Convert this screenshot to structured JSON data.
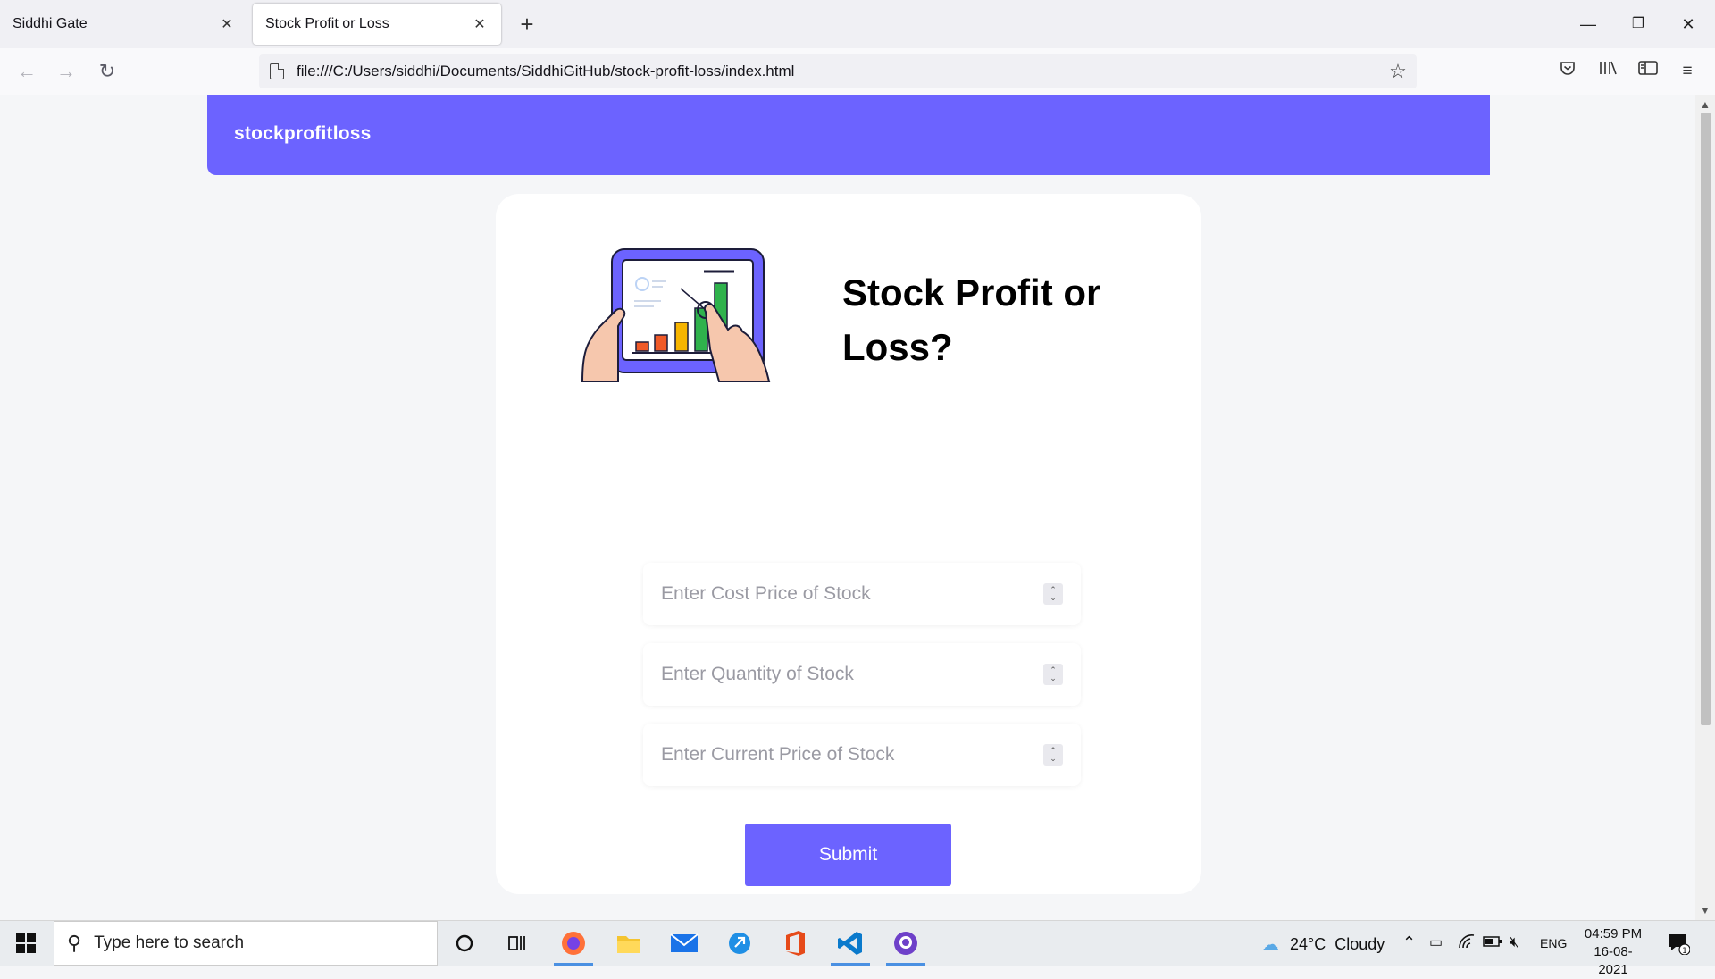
{
  "browser": {
    "tabs": [
      {
        "title": "Siddhi Gate",
        "active": false
      },
      {
        "title": "Stock Profit or Loss",
        "active": true
      }
    ],
    "url": "file:///C:/Users/siddhi/Documents/SiddhiGitHub/stock-profit-loss/index.html",
    "window_controls": {
      "minimize": "—",
      "restore": "❐",
      "close": "✕"
    }
  },
  "page": {
    "brand": "stockprofitloss",
    "title": "Stock Profit or Loss?",
    "title_line1": "Stock Profit or",
    "title_line2": "Loss?",
    "inputs": [
      {
        "placeholder": "Enter Cost Price of Stock",
        "value": ""
      },
      {
        "placeholder": "Enter Quantity of Stock",
        "value": ""
      },
      {
        "placeholder": "Enter Current Price of Stock",
        "value": ""
      }
    ],
    "submit_label": "Submit",
    "colors": {
      "accent": "#6c63ff",
      "card": "#ffffff",
      "background": "#f5f6f8"
    }
  },
  "taskbar": {
    "search_placeholder": "Type here to search",
    "pinned_apps": [
      "cortana-icon",
      "task-view-icon",
      "firefox-icon",
      "file-explorer-icon",
      "mail-icon",
      "edge-icon",
      "office-icon",
      "vscode-icon",
      "github-desktop-icon"
    ],
    "weather": "24°C  Cloudy",
    "language": "ENG",
    "time": "04:59 PM",
    "date": "16-08-2021",
    "notification_count": "1"
  }
}
